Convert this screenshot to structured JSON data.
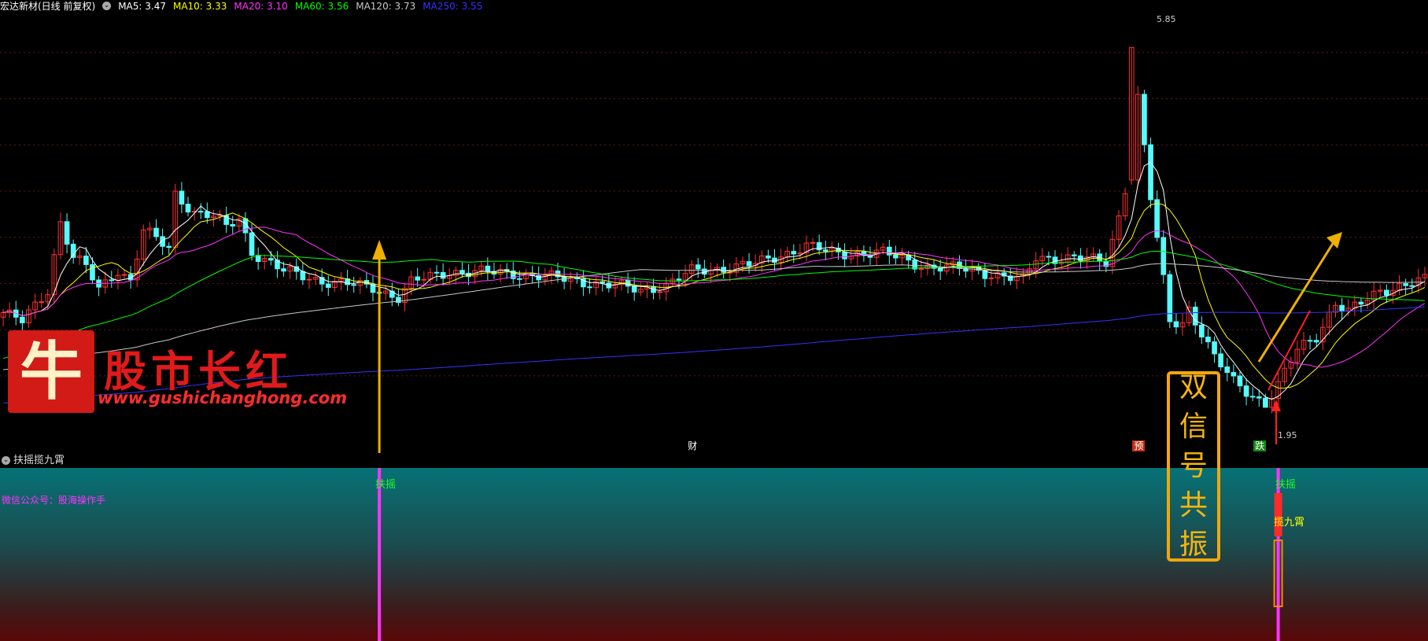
{
  "legend": {
    "title": "宏达新材(日线 前复权)",
    "items": [
      {
        "label": "MA5: 3.47",
        "color": "#ffffff"
      },
      {
        "label": "MA10: 3.33",
        "color": "#ffff00"
      },
      {
        "label": "MA20: 3.10",
        "color": "#ff33ff"
      },
      {
        "label": "MA60: 3.56",
        "color": "#00ff00"
      },
      {
        "label": "MA120: 3.73",
        "color": "#c8c8c8"
      },
      {
        "label": "MA250: 3.55",
        "color": "#3333ff"
      }
    ]
  },
  "indicator": {
    "title": "扶摇揽九霄",
    "wechat": "微信公众号：股海操作手",
    "signal_fuyao": "扶摇",
    "signal_lanjiuxiao": "揽九霄"
  },
  "events": [
    {
      "label": "财",
      "index": 108,
      "color": "#ffffff",
      "bg": "#000000"
    },
    {
      "label": "预",
      "index": 178,
      "color": "#ffffff",
      "bg": "#c03010"
    },
    {
      "label": "跌",
      "index": 197,
      "color": "#ffffff",
      "bg": "#118811"
    }
  ],
  "callout": {
    "chars": [
      "双",
      "信",
      "号",
      "共",
      "振"
    ]
  },
  "watermark": {
    "char": "牛",
    "title": "股市长红",
    "url": "www.gushichanghong.com"
  },
  "annotations": {
    "high_label": "5.85",
    "low_label": "1.95"
  },
  "colors": {
    "up": "#ff3232",
    "down": "#54fcfc",
    "signal": "#ff33ff",
    "arrow": "#f0b000",
    "red_arrow": "#ff2020"
  },
  "chart_data": {
    "type": "candlestick",
    "ylim": [
      1.5,
      6.3
    ],
    "visible_bars": 224,
    "price_path": [
      [
        0,
        2.95
      ],
      [
        3,
        2.85
      ],
      [
        7,
        3.2
      ],
      [
        9,
        3.95
      ],
      [
        11,
        3.55
      ],
      [
        13,
        3.45
      ],
      [
        15,
        3.2
      ],
      [
        18,
        3.42
      ],
      [
        20,
        3.3
      ],
      [
        22,
        3.85
      ],
      [
        26,
        3.65
      ],
      [
        27,
        4.25
      ],
      [
        30,
        4.05
      ],
      [
        33,
        4.0
      ],
      [
        35,
        3.88
      ],
      [
        37,
        3.98
      ],
      [
        39,
        3.62
      ],
      [
        44,
        3.4
      ],
      [
        50,
        3.3
      ],
      [
        58,
        3.22
      ],
      [
        62,
        3.12
      ],
      [
        64,
        3.28
      ],
      [
        70,
        3.4
      ],
      [
        80,
        3.38
      ],
      [
        90,
        3.3
      ],
      [
        100,
        3.2
      ],
      [
        104,
        3.25
      ],
      [
        108,
        3.4
      ],
      [
        118,
        3.48
      ],
      [
        126,
        3.68
      ],
      [
        130,
        3.6
      ],
      [
        138,
        3.6
      ],
      [
        145,
        3.45
      ],
      [
        152,
        3.42
      ],
      [
        160,
        3.3
      ],
      [
        162,
        3.55
      ],
      [
        168,
        3.55
      ],
      [
        173,
        3.5
      ],
      [
        175,
        4.0
      ],
      [
        176,
        4.5
      ],
      [
        177,
        5.85
      ],
      [
        180,
        4.2
      ],
      [
        183,
        2.85
      ],
      [
        185,
        2.85
      ],
      [
        186,
        3.0
      ],
      [
        190,
        2.45
      ],
      [
        193,
        2.2
      ],
      [
        197,
        2.0
      ],
      [
        198,
        1.95
      ],
      [
        200,
        2.15
      ],
      [
        203,
        2.55
      ],
      [
        206,
        2.7
      ],
      [
        209,
        3.05
      ],
      [
        211,
        2.95
      ],
      [
        214,
        3.1
      ],
      [
        216,
        3.2
      ],
      [
        220,
        3.25
      ],
      [
        223,
        3.3
      ]
    ],
    "signals": [
      59,
      200
    ]
  }
}
